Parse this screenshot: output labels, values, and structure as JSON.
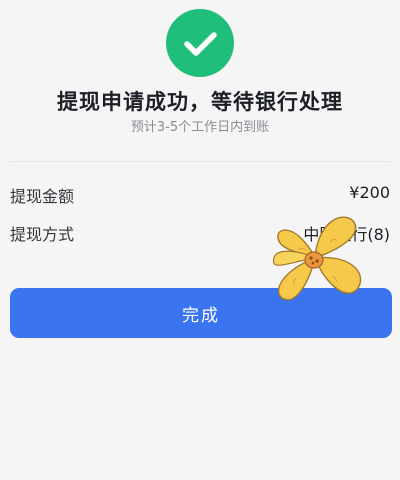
{
  "status": {
    "icon": "check-icon",
    "title": "提现申请成功，等待银行处理",
    "subtitle": "预计3-5个工作日内到账"
  },
  "details": {
    "amount_label": "提现金额",
    "amount_value": "¥200",
    "method_label": "提现方式",
    "method_value": "中国银行(8)"
  },
  "actions": {
    "done_label": "完成"
  },
  "sticker": {
    "icon": "flower-sticker"
  },
  "colors": {
    "success": "#1fbf7b",
    "primary": "#3b74f1",
    "background": "#f5f5f6"
  }
}
